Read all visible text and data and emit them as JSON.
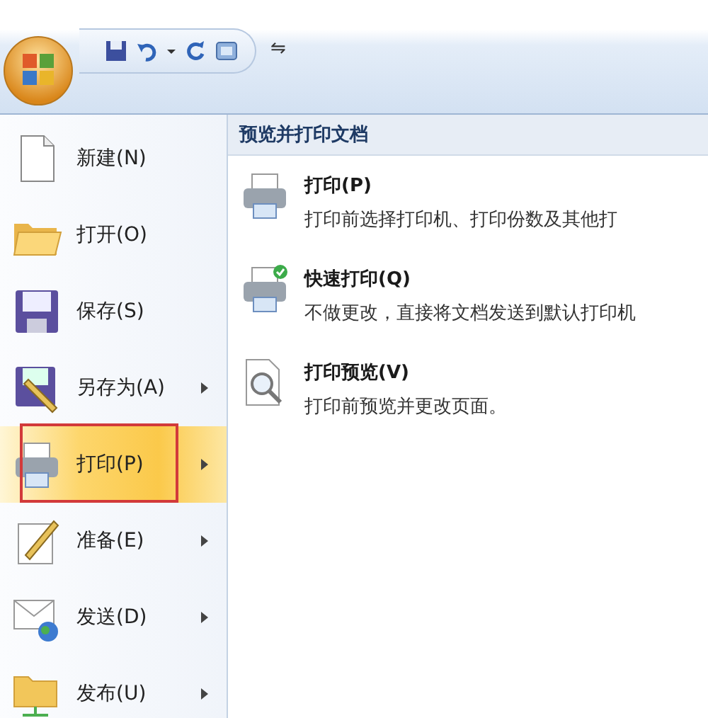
{
  "quick_access_toolbar": {
    "items": [
      {
        "kind": "save"
      },
      {
        "kind": "undo"
      },
      {
        "kind": "dropdown"
      },
      {
        "kind": "redo"
      },
      {
        "kind": "window"
      }
    ],
    "customize": "⇋"
  },
  "menu": {
    "items": [
      {
        "kind": "new",
        "label": "新建(N)",
        "submenu": false,
        "selected": false,
        "outlined": false
      },
      {
        "kind": "open",
        "label": "打开(O)",
        "submenu": false,
        "selected": false,
        "outlined": false
      },
      {
        "kind": "save",
        "label": "保存(S)",
        "submenu": false,
        "selected": false,
        "outlined": false
      },
      {
        "kind": "saveas",
        "label": "另存为(A)",
        "submenu": true,
        "selected": false,
        "outlined": false
      },
      {
        "kind": "print",
        "label": "打印(P)",
        "submenu": true,
        "selected": true,
        "outlined": true
      },
      {
        "kind": "prepare",
        "label": "准备(E)",
        "submenu": true,
        "selected": false,
        "outlined": false
      },
      {
        "kind": "send",
        "label": "发送(D)",
        "submenu": true,
        "selected": false,
        "outlined": false
      },
      {
        "kind": "publish",
        "label": "发布(U)",
        "submenu": true,
        "selected": false,
        "outlined": false
      }
    ]
  },
  "submenu": {
    "title": "预览并打印文档",
    "items": [
      {
        "kind": "print",
        "title": "打印(P)",
        "description": "打印前选择打印机、打印份数及其他打"
      },
      {
        "kind": "quickprint",
        "title": "快速打印(Q)",
        "description": "不做更改，直接将文档发送到默认打印机"
      },
      {
        "kind": "preview",
        "title": "打印预览(V)",
        "description": "打印前预览并更改页面。"
      }
    ]
  }
}
